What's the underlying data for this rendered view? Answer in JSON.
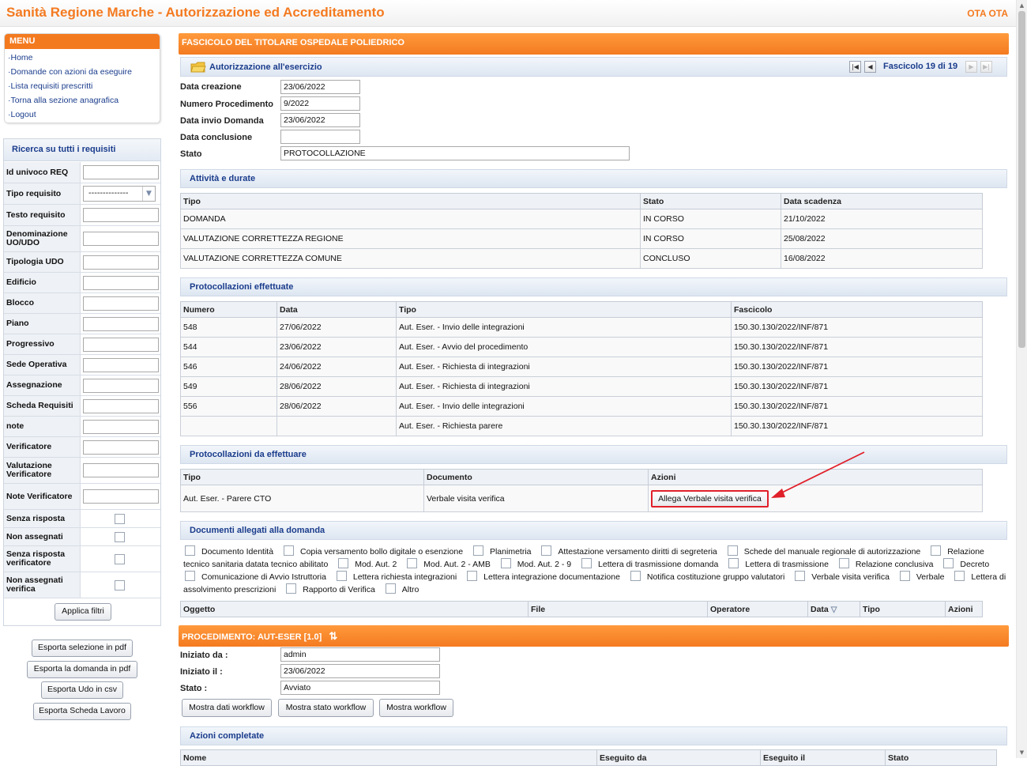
{
  "header": {
    "title": "Sanità Regione Marche - Autorizzazione ed Accreditamento",
    "user": "OTA OTA"
  },
  "menu": {
    "title": "MENU",
    "items": [
      "·Home",
      "·Domande con azioni da eseguire",
      "·Lista requisiti prescritti",
      "·Torna alla sezione anagrafica",
      "·Logout"
    ]
  },
  "search": {
    "title": "Ricerca su tutti i requisiti",
    "fields": [
      "Id univoco REQ",
      "Tipo requisito",
      "Testo requisito",
      "Denominazione UO/UDO",
      "Tipologia UDO",
      "Edificio",
      "Blocco",
      "Piano",
      "Progressivo",
      "Sede Operativa",
      "Assegnazione",
      "Scheda Requisiti",
      "note",
      "Verificatore",
      "Valutazione Verificatore",
      "Note Verificatore"
    ],
    "tipo_requisito_value": "--------------",
    "checks": [
      "Senza risposta",
      "Non assegnati",
      "Senza risposta verificatore",
      "Non assegnati verifica"
    ],
    "apply_label": "Applica filtri"
  },
  "left_buttons": [
    "Esporta selezione in pdf",
    "Esporta la domanda in pdf",
    "Esporta Udo in csv",
    "Esporta Scheda Lavoro"
  ],
  "fascicolo": {
    "title": "FASCICOLO DEL TITOLARE OSPEDALE POLIEDRICO",
    "section": "Autorizzazione all'esercizio",
    "pager": "Fascicolo 19 di 19",
    "fields": [
      {
        "label": "Data creazione",
        "value": "23/06/2022"
      },
      {
        "label": "Numero Procedimento",
        "value": "9/2022"
      },
      {
        "label": "Data invio Domanda",
        "value": "23/06/2022"
      },
      {
        "label": "Data conclusione",
        "value": ""
      },
      {
        "label": "Stato",
        "value": "PROTOCOLLAZIONE"
      }
    ]
  },
  "attivita": {
    "title": "Attività e durate",
    "headers": [
      "Tipo",
      "Stato",
      "Data scadenza"
    ],
    "rows": [
      [
        "DOMANDA",
        "IN CORSO",
        "21/10/2022"
      ],
      [
        "VALUTAZIONE CORRETTEZZA REGIONE",
        "IN CORSO",
        "25/08/2022"
      ],
      [
        "VALUTAZIONE CORRETTEZZA COMUNE",
        "CONCLUSO",
        "16/08/2022"
      ]
    ]
  },
  "protocollazioni": {
    "title": "Protocollazioni effettuate",
    "headers": [
      "Numero",
      "Data",
      "Tipo",
      "Fascicolo"
    ],
    "rows": [
      [
        "548",
        "27/06/2022",
        "Aut. Eser. - Invio delle integrazioni",
        "150.30.130/2022/INF/871"
      ],
      [
        "544",
        "23/06/2022",
        "Aut. Eser. - Avvio del procedimento",
        "150.30.130/2022/INF/871"
      ],
      [
        "546",
        "24/06/2022",
        "Aut. Eser. - Richiesta di integrazioni",
        "150.30.130/2022/INF/871"
      ],
      [
        "549",
        "28/06/2022",
        "Aut. Eser. - Richiesta di integrazioni",
        "150.30.130/2022/INF/871"
      ],
      [
        "556",
        "28/06/2022",
        "Aut. Eser. - Invio delle integrazioni",
        "150.30.130/2022/INF/871"
      ],
      [
        "",
        "",
        "Aut. Eser. - Richiesta parere",
        "150.30.130/2022/INF/871"
      ]
    ]
  },
  "da_effettuare": {
    "title": "Protocollazioni da effettuare",
    "headers": [
      "Tipo",
      "Documento",
      "Azioni"
    ],
    "row": {
      "tipo": "Aut. Eser. - Parere CTO",
      "documento": "Verbale visita verifica",
      "action_label": "Allega Verbale visita verifica"
    }
  },
  "documenti": {
    "title": "Documenti allegati alla domanda",
    "checkboxes": [
      "Documento Identità",
      "Copia versamento bollo digitale o esenzione",
      "Planimetria",
      "Attestazione versamento diritti di segreteria",
      "Schede del manuale regionale di autorizzazione",
      "Relazione tecnico sanitaria datata tecnico abilitato",
      "Mod. Aut. 2",
      "Mod. Aut. 2 - AMB",
      "Mod. Aut. 2 - 9",
      "Lettera di trasmissione domanda",
      "Lettera di trasmissione",
      "Relazione conclusiva",
      "Decreto",
      "Comunicazione di Avvio Istruttoria",
      "Lettera richiesta integrazioni",
      "Lettera integrazione documentazione",
      "Notifica costituzione gruppo valutatori",
      "Verbale visita verifica",
      "Verbale",
      "Lettera di assolvimento prescrizioni",
      "Rapporto di Verifica",
      "Altro"
    ],
    "headers": [
      "Oggetto",
      "File",
      "Operatore",
      "Data",
      "Tipo",
      "Azioni"
    ]
  },
  "procedimento": {
    "title": "PROCEDIMENTO: AUT-ESER [1.0]",
    "fields": [
      {
        "label": "Iniziato da :",
        "value": "admin"
      },
      {
        "label": "Iniziato il :",
        "value": "23/06/2022"
      },
      {
        "label": "Stato :",
        "value": "Avviato"
      }
    ],
    "buttons": [
      "Mostra dati workflow",
      "Mostra stato workflow",
      "Mostra workflow"
    ],
    "azioni_title": "Azioni completate",
    "azioni_headers": [
      "Nome",
      "Eseguito da",
      "Eseguito il",
      "Stato"
    ]
  },
  "colors": {
    "accent": "#f47a20",
    "link": "#1a3c8c",
    "highlight": "#e0202a"
  }
}
